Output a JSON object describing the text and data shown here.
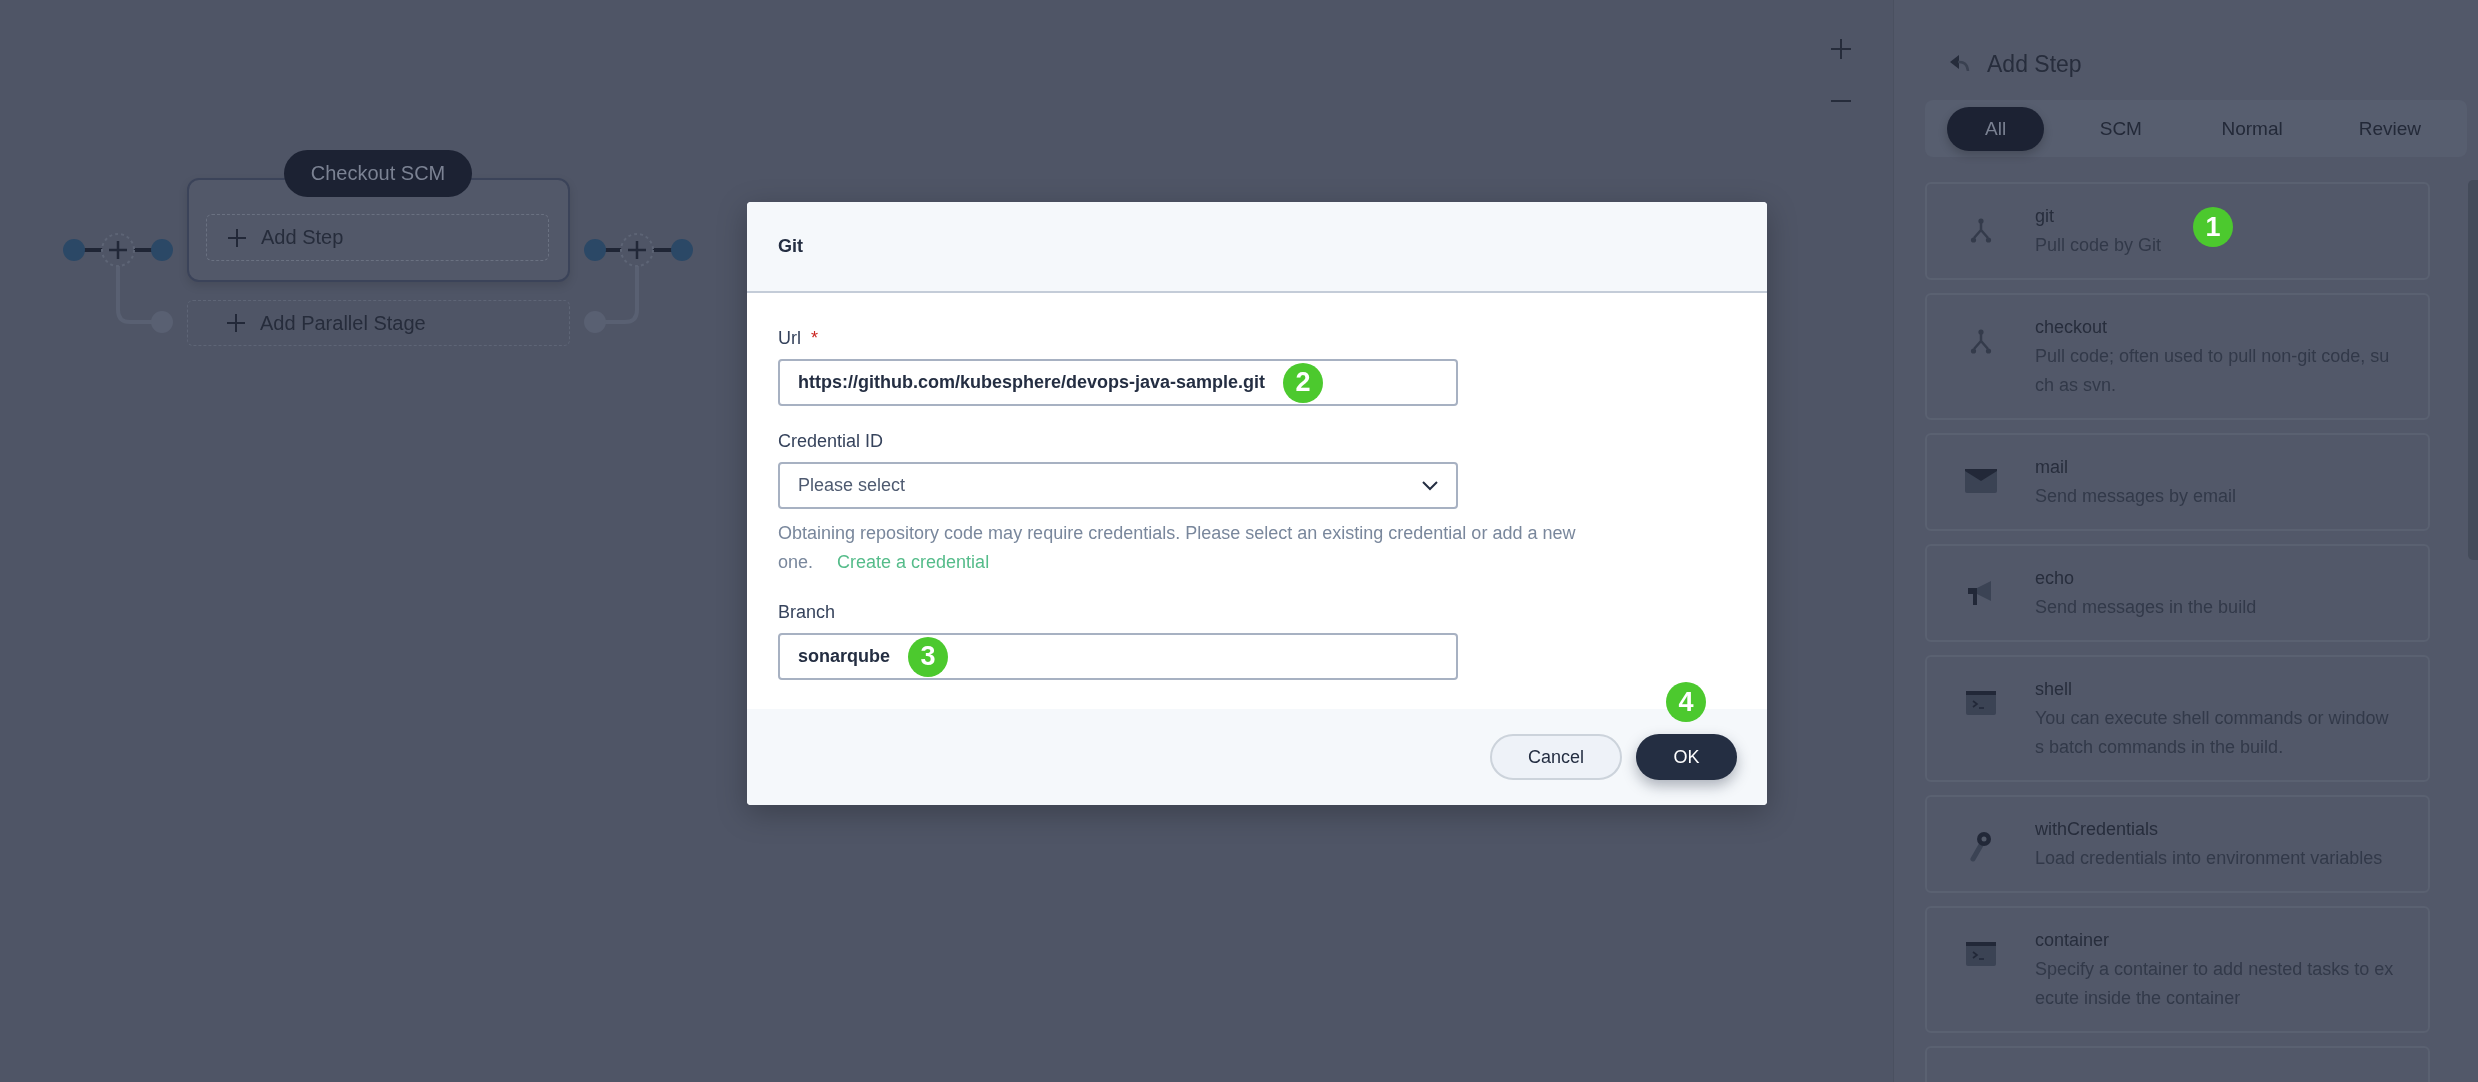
{
  "canvas": {
    "stage": {
      "title": "Checkout SCM",
      "add_step": "Add Step",
      "add_parallel": "Add Parallel Stage"
    }
  },
  "panel": {
    "title": "Add Step",
    "tabs": [
      {
        "label": "All",
        "selected": true
      },
      {
        "label": "SCM",
        "selected": false
      },
      {
        "label": "Normal",
        "selected": false
      },
      {
        "label": "Review",
        "selected": false
      }
    ],
    "steps": [
      {
        "kind": "branch",
        "name": "git",
        "description": "Pull code by Git",
        "badge": "1"
      },
      {
        "kind": "branch",
        "name": "checkout",
        "description": "Pull code; often used to pull non-git code, such as svn."
      },
      {
        "kind": "mail",
        "name": "mail",
        "description": "Send messages by email"
      },
      {
        "kind": "megaphone",
        "name": "echo",
        "description": "Send messages in the build"
      },
      {
        "kind": "terminal",
        "name": "shell",
        "description": "You can execute shell commands or windows batch commands in the build."
      },
      {
        "kind": "key",
        "name": "withCredentials",
        "description": "Load credentials into environment variables"
      },
      {
        "kind": "terminal",
        "name": "container",
        "description": "Specify a container to add nested tasks to execute inside the container"
      }
    ]
  },
  "dialog": {
    "title": "Git",
    "fields": [
      {
        "kind": "text",
        "label": "Url",
        "required_mark": "*",
        "value": "https://github.com/kubesphere/devops-java-sample.git",
        "badge": "2"
      },
      {
        "kind": "select",
        "label": "Credential ID",
        "placeholder": "Please select",
        "help": "Obtaining repository code may require credentials. Please select an existing credential or add a new one.",
        "link": "Create a credential"
      },
      {
        "kind": "text",
        "label": "Branch",
        "value": "sonarqube",
        "badge": "3"
      }
    ],
    "buttons": [
      {
        "kind": "secondary",
        "label": "Cancel"
      },
      {
        "kind": "primary",
        "label": "OK",
        "badge": "4"
      }
    ]
  }
}
